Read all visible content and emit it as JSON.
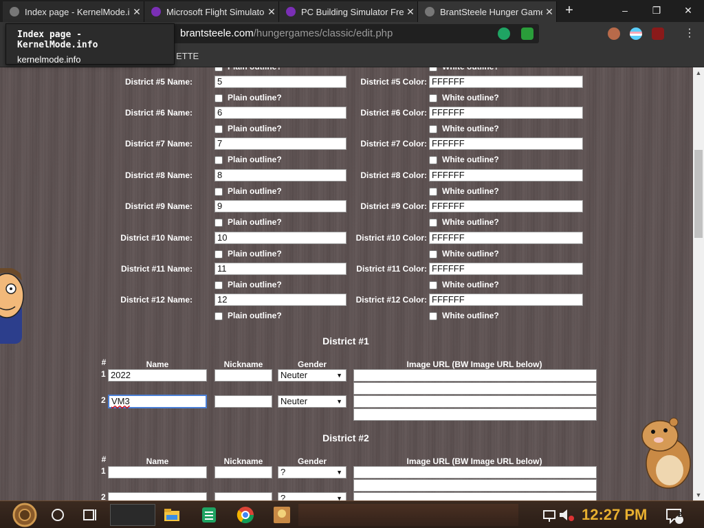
{
  "browser": {
    "tabs": [
      {
        "title": "Index page - KernelMode.info",
        "close": "✕"
      },
      {
        "title": "Microsoft Flight Simulator",
        "close": "✕"
      },
      {
        "title": "PC Building Simulator Free",
        "close": "✕"
      },
      {
        "title": "BrantSteele Hunger Games",
        "close": "✕"
      }
    ],
    "new_tab": "+",
    "window_controls": {
      "minimize": "–",
      "maximize": "❐",
      "close": "✕"
    },
    "address": {
      "host": "brantsteele.com",
      "path": "/hungergames/classic/edit.php"
    },
    "bookmark_label": "ETTE",
    "tooltip": {
      "title": "Index page - KernelMode.info",
      "url": "kernelmode.info"
    }
  },
  "districts_top": [
    {
      "name_label": "District #5 Name:",
      "name_value": "5",
      "color_label": "District #5 Color:",
      "color_value": "FFFFFF"
    },
    {
      "name_label": "District #6 Name:",
      "name_value": "6",
      "color_label": "District #6 Color:",
      "color_value": "FFFFFF"
    },
    {
      "name_label": "District #7 Name:",
      "name_value": "7",
      "color_label": "District #7 Color:",
      "color_value": "FFFFFF"
    },
    {
      "name_label": "District #8 Name:",
      "name_value": "8",
      "color_label": "District #8 Color:",
      "color_value": "FFFFFF"
    },
    {
      "name_label": "District #9 Name:",
      "name_value": "9",
      "color_label": "District #9 Color:",
      "color_value": "FFFFFF"
    },
    {
      "name_label": "District #10 Name:",
      "name_value": "10",
      "color_label": "District #10 Color:",
      "color_value": "FFFFFF"
    },
    {
      "name_label": "District #11 Name:",
      "name_value": "11",
      "color_label": "District #11 Color:",
      "color_value": "FFFFFF"
    },
    {
      "name_label": "District #12 Name:",
      "name_value": "12",
      "color_label": "District #12 Color:",
      "color_value": "FFFFFF"
    }
  ],
  "plain_outline_label": "Plain outline?",
  "white_outline_label": "White outline?",
  "columns": {
    "num": "#",
    "name": "Name",
    "nickname": "Nickname",
    "gender": "Gender",
    "image": "Image URL (BW Image URL below)"
  },
  "district_sections": [
    {
      "heading": "District #1",
      "tributes": [
        {
          "num": "1",
          "name": "2022",
          "nickname": "",
          "gender": "Neuter"
        },
        {
          "num": "2",
          "name": "VM3",
          "nickname": "",
          "gender": "Neuter"
        }
      ]
    },
    {
      "heading": "District #2",
      "tributes": [
        {
          "num": "1",
          "name": "",
          "nickname": "",
          "gender": "?"
        },
        {
          "num": "2",
          "name": "",
          "nickname": "",
          "gender": "?"
        }
      ]
    }
  ],
  "taskbar": {
    "clock": "12:27 PM",
    "notifications": "2"
  },
  "colors": {
    "page_bg": "#5e5252",
    "clock": "#e8b030",
    "chrome_dark": "#1e1e1e"
  },
  "icons": [
    "windows-logo-icon",
    "cortana-icon",
    "task-view-icon",
    "file-explorer-icon",
    "sheets-icon",
    "chrome-icon",
    "game-icon",
    "network-icon",
    "volume-muted-icon",
    "notification-icon"
  ]
}
